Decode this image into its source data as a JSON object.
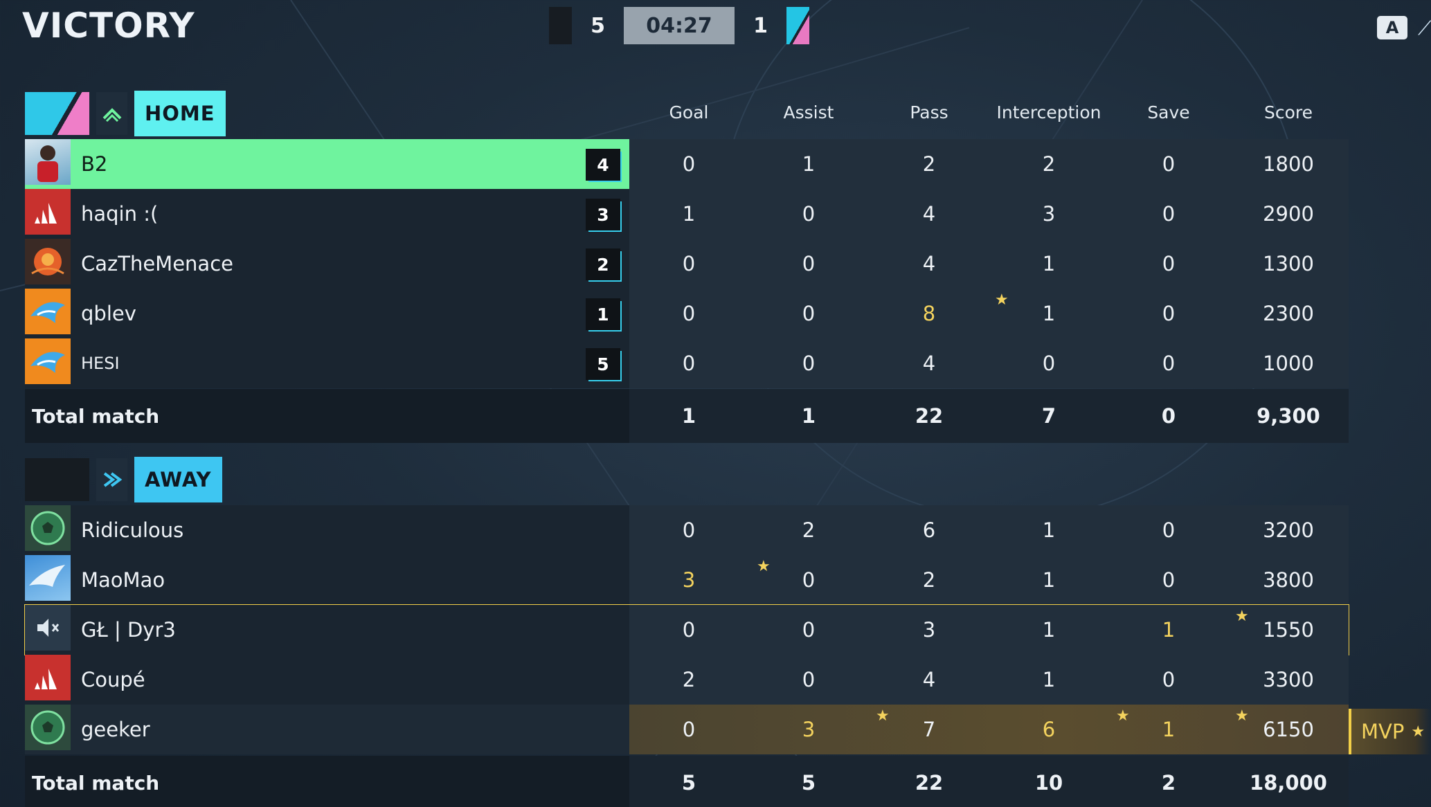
{
  "header": {
    "result": "VICTORY",
    "home_score": "5",
    "time": "04:27",
    "away_score": "1",
    "key_hint": "A"
  },
  "columns": [
    "Goal",
    "Assist",
    "Pass",
    "Interception",
    "Save",
    "Score"
  ],
  "home": {
    "name": "HOME",
    "color": "#5ff0f0",
    "players": [
      {
        "name": "B2",
        "position": "4",
        "goal": "0",
        "assist": "1",
        "pass": "2",
        "interception": "2",
        "save": "0",
        "score": "1800",
        "avatar": "player-photo-avatar"
      },
      {
        "name": "haqin :(",
        "position": "3",
        "goal": "1",
        "assist": "0",
        "pass": "4",
        "interception": "3",
        "save": "0",
        "score": "2900",
        "avatar": "adidas-logo-avatar"
      },
      {
        "name": "CazTheMenace",
        "position": "2",
        "goal": "0",
        "assist": "0",
        "pass": "4",
        "interception": "1",
        "save": "0",
        "score": "1300",
        "avatar": "fire-emblem-avatar"
      },
      {
        "name": "qblev",
        "position": "1",
        "goal": "0",
        "assist": "0",
        "pass": "8",
        "interception": "1",
        "save": "0",
        "score": "2300",
        "avatar": "shark-avatar"
      },
      {
        "name": "HESI",
        "position": "5",
        "goal": "0",
        "assist": "0",
        "pass": "4",
        "interception": "0",
        "save": "0",
        "score": "1000",
        "avatar": "shark-avatar"
      }
    ],
    "total": {
      "label": "Total match",
      "goal": "1",
      "assist": "1",
      "pass": "22",
      "interception": "7",
      "save": "0",
      "score": "9,300"
    }
  },
  "away": {
    "name": "AWAY",
    "color": "#3ec6f2",
    "players": [
      {
        "name": "Ridiculous",
        "goal": "0",
        "assist": "2",
        "pass": "6",
        "interception": "1",
        "save": "0",
        "score": "3200",
        "avatar": "soccer-ball-avatar"
      },
      {
        "name": "MaoMao",
        "goal": "3",
        "assist": "0",
        "pass": "2",
        "interception": "1",
        "save": "0",
        "score": "3800",
        "avatar": "bird-avatar"
      },
      {
        "name": "GŁ | Dyr3",
        "goal": "0",
        "assist": "0",
        "pass": "3",
        "interception": "1",
        "save": "1",
        "score": "1550",
        "avatar": "muted-speaker-avatar"
      },
      {
        "name": "Coupé",
        "goal": "2",
        "assist": "0",
        "pass": "4",
        "interception": "1",
        "save": "0",
        "score": "3300",
        "avatar": "adidas-logo-avatar"
      },
      {
        "name": "geeker",
        "goal": "0",
        "assist": "3",
        "pass": "7",
        "interception": "6",
        "save": "1",
        "score": "6150",
        "avatar": "soccer-ball-avatar"
      }
    ],
    "total": {
      "label": "Total match",
      "goal": "5",
      "assist": "5",
      "pass": "22",
      "interception": "10",
      "save": "2",
      "score": "18,000"
    }
  },
  "mvp_label": "MVP",
  "colors": {
    "highlight": "#6ff39e",
    "gold": "#f4d35e",
    "accent": "#37d0ee"
  }
}
